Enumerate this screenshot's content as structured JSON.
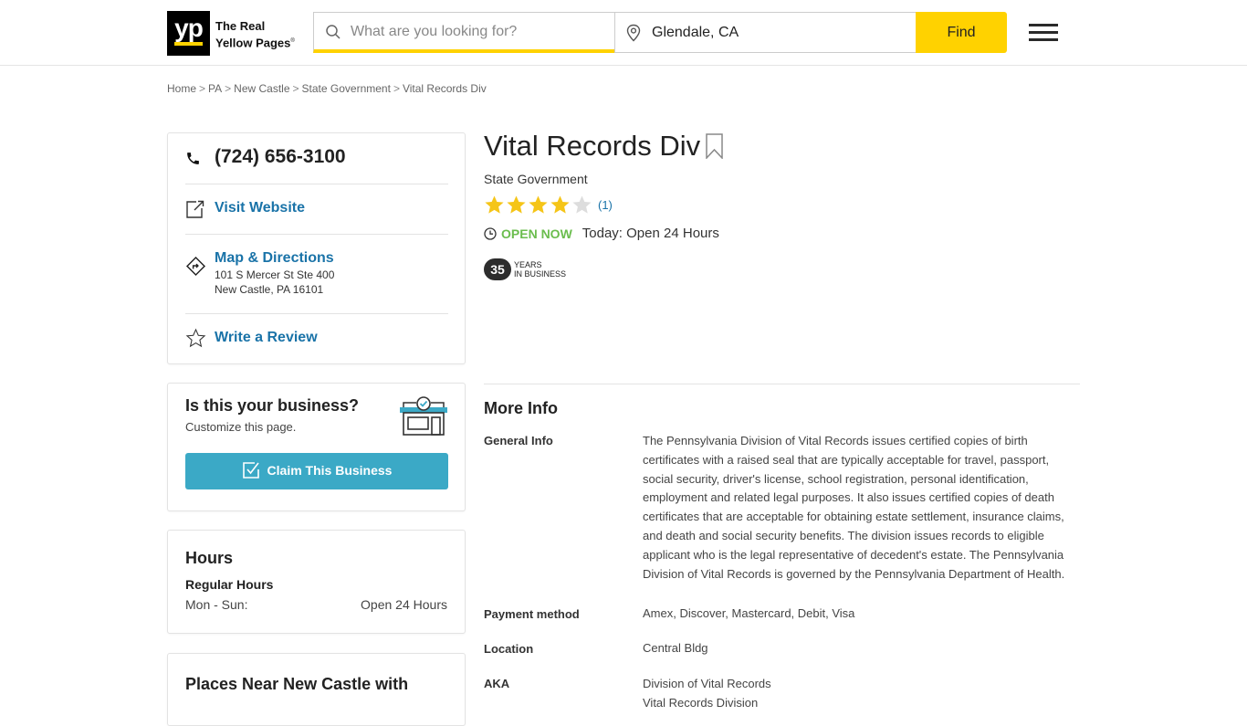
{
  "header": {
    "logo_text": "yp",
    "logo_tagline_line1": "The Real",
    "logo_tagline_line2": "Yellow Pages",
    "search_placeholder": "What are you looking for?",
    "search_value": "",
    "location_value": "Glendale, CA",
    "find_label": "Find",
    "brand_color": "#ffd200"
  },
  "breadcrumb": [
    {
      "label": "Home"
    },
    {
      "label": "PA"
    },
    {
      "label": "New Castle"
    },
    {
      "label": "State Government"
    },
    {
      "label": "Vital Records Div"
    }
  ],
  "contact": {
    "phone": "(724) 656-3100",
    "visit_website": "Visit Website",
    "map_directions": "Map & Directions",
    "address_line1": "101 S Mercer St Ste 400",
    "address_line2": "New Castle, PA 16101",
    "write_review": "Write a Review"
  },
  "claim": {
    "title": "Is this your business?",
    "subtitle": "Customize this page.",
    "button": "Claim This Business"
  },
  "hours": {
    "title": "Hours",
    "subtitle": "Regular Hours",
    "rows": [
      {
        "days": "Mon - Sun:",
        "value": "Open 24 Hours"
      }
    ]
  },
  "nearby": {
    "title": "Places Near New Castle with"
  },
  "business": {
    "name": "Vital Records Div",
    "category": "State Government",
    "rating": 4,
    "rating_max": 5,
    "review_count": "(1)",
    "open_status": "OPEN NOW",
    "today_hours": "Today: Open 24 Hours",
    "years_in_business": "35",
    "years_label_line1": "YEARS",
    "years_label_line2": "IN BUSINESS"
  },
  "more_info": {
    "title": "More Info",
    "rows": [
      {
        "label": "General Info",
        "value": "The Pennsylvania Division of Vital Records issues certified copies of birth certificates with a raised seal that are typically acceptable for travel, passport, social security, driver's license, school registration, personal identification, employment and related legal purposes. It also issues certified copies of death certificates that are acceptable for obtaining estate settlement, insurance claims, and death and social security benefits. The division issues records to eligible applicant who is the legal representative of decedent's estate. The Pennsylvania Division of Vital Records is governed by the Pennsylvania Department of Health."
      },
      {
        "label": "Payment method",
        "value": "Amex, Discover, Mastercard, Debit, Visa"
      },
      {
        "label": "Location",
        "value": "Central Bldg"
      },
      {
        "label": "AKA",
        "value": "Division of Vital Records",
        "value2": "Vital Records Division"
      }
    ]
  },
  "colors": {
    "link": "#1a73a8",
    "open": "#6bbd4e",
    "claim_button": "#3ba9c6",
    "star_filled": "#f5c518",
    "star_empty": "#dddddd"
  }
}
